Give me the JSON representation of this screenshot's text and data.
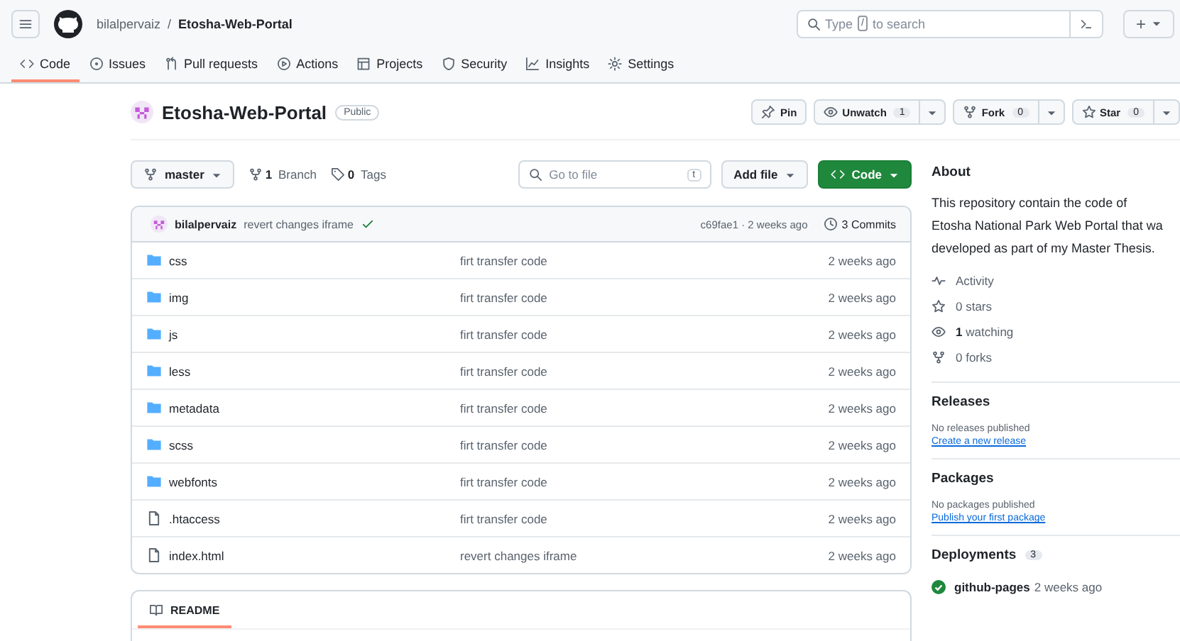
{
  "header": {
    "owner": "bilalpervaiz",
    "separator": "/",
    "repo": "Etosha-Web-Portal",
    "search": {
      "before": "Type",
      "key": "/",
      "after": "to search"
    },
    "new_button": "+"
  },
  "tabs": [
    {
      "label": "Code",
      "selected": true
    },
    {
      "label": "Issues",
      "selected": false
    },
    {
      "label": "Pull requests",
      "selected": false
    },
    {
      "label": "Actions",
      "selected": false
    },
    {
      "label": "Projects",
      "selected": false
    },
    {
      "label": "Security",
      "selected": false
    },
    {
      "label": "Insights",
      "selected": false
    },
    {
      "label": "Settings",
      "selected": false
    }
  ],
  "repo": {
    "name": "Etosha-Web-Portal",
    "visibility": "Public",
    "pin": "Pin",
    "watch": {
      "label": "Unwatch",
      "count": "1"
    },
    "fork": {
      "label": "Fork",
      "count": "0"
    },
    "star": {
      "label": "Star",
      "count": "0"
    }
  },
  "toolbar": {
    "branch": "master",
    "branches": {
      "count": "1",
      "label": "Branch"
    },
    "tags": {
      "count": "0",
      "label": "Tags"
    },
    "goto": {
      "placeholder": "Go to file",
      "key": "t"
    },
    "add_file": "Add file",
    "code": "Code"
  },
  "commit": {
    "author": "bilalpervaiz",
    "message": "revert changes iframe",
    "checks_passed": true,
    "meta": "c69fae1 · 2 weeks ago",
    "commits": "3 Commits"
  },
  "files": [
    {
      "kind": "dir",
      "name": "css",
      "message": "firt transfer code",
      "time": "2 weeks ago"
    },
    {
      "kind": "dir",
      "name": "img",
      "message": "firt transfer code",
      "time": "2 weeks ago"
    },
    {
      "kind": "dir",
      "name": "js",
      "message": "firt transfer code",
      "time": "2 weeks ago"
    },
    {
      "kind": "dir",
      "name": "less",
      "message": "firt transfer code",
      "time": "2 weeks ago"
    },
    {
      "kind": "dir",
      "name": "metadata",
      "message": "firt transfer code",
      "time": "2 weeks ago"
    },
    {
      "kind": "dir",
      "name": "scss",
      "message": "firt transfer code",
      "time": "2 weeks ago"
    },
    {
      "kind": "dir",
      "name": "webfonts",
      "message": "firt transfer code",
      "time": "2 weeks ago"
    },
    {
      "kind": "file",
      "name": ".htaccess",
      "message": "firt transfer code",
      "time": "2 weeks ago"
    },
    {
      "kind": "file",
      "name": "index.html",
      "message": "revert changes iframe",
      "time": "2 weeks ago"
    }
  ],
  "readme": {
    "label": "README",
    "selected": true
  },
  "about": {
    "title": "About",
    "description": [
      "This repository contain the code of",
      "Etosha National Park Web Portal that wa",
      "developed as part of my Master Thesis."
    ],
    "stats": [
      {
        "kind": "activity",
        "text": "Activity"
      },
      {
        "kind": "stars",
        "text": "0 stars"
      },
      {
        "kind": "watching",
        "text": "**1** watching"
      },
      {
        "kind": "forks",
        "text": "0 forks"
      }
    ]
  },
  "releases": {
    "title": "Releases",
    "text": "No releases published",
    "link": "Create a new release"
  },
  "packages": {
    "title": "Packages",
    "text": "No packages published",
    "link": "Publish your first package"
  },
  "deployments": {
    "title": "Deployments",
    "count": "3",
    "items": [
      {
        "name": "github-pages",
        "time": "2 weeks ago",
        "success": true
      }
    ]
  }
}
